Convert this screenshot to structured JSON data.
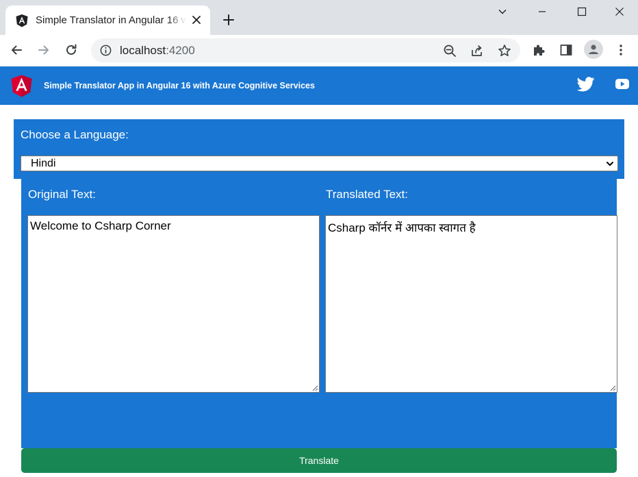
{
  "browser": {
    "tab_title": "Simple Translator in Angular 16 with Azure Cognitive Services",
    "url_host": "localhost",
    "url_port": ":4200"
  },
  "icons": {
    "favicon": "angular-icon",
    "tab_close": "close-icon",
    "new_tab": "plus-icon",
    "back": "back-arrow-icon",
    "forward": "forward-arrow-icon",
    "reload": "reload-icon",
    "site_info": "info-icon",
    "zoom": "zoom-out-icon",
    "share": "share-icon",
    "bookmark": "star-icon",
    "extensions": "puzzle-icon",
    "side_panel": "side-panel-icon",
    "profile": "profile-icon",
    "menu": "kebab-menu-icon",
    "twitter": "twitter-icon",
    "youtube": "youtube-icon"
  },
  "header": {
    "title": "Simple Translator App in Angular 16 with Azure Cognitive Services"
  },
  "language": {
    "label": "Choose a Language:",
    "selected": "Hindi"
  },
  "original": {
    "label": "Original Text:",
    "value": "Welcome to Csharp Corner"
  },
  "translated": {
    "label": "Translated Text:",
    "value": "Csharp कॉर्नर में आपका स्वागत है"
  },
  "actions": {
    "translate_label": "Translate"
  },
  "colors": {
    "header_bg": "#1976d2",
    "panel_bg": "#1976d2",
    "button_bg": "#198754",
    "angular_red": "#dd0031"
  }
}
